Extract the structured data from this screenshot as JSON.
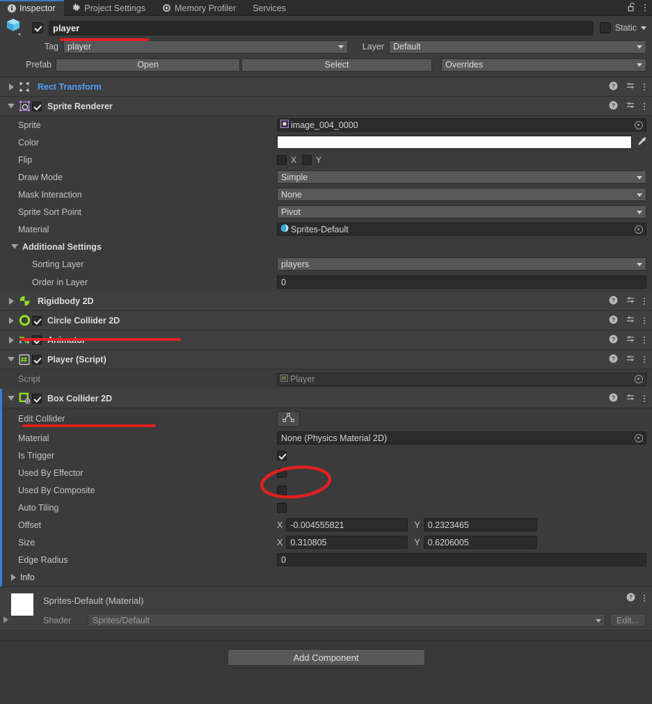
{
  "window": {
    "tabs": [
      {
        "label": "Inspector",
        "icon": "info-icon",
        "active": true
      },
      {
        "label": "Project Settings",
        "icon": "gear-icon",
        "active": false
      },
      {
        "label": "Memory Profiler",
        "icon": "memory-chip-icon",
        "active": false
      },
      {
        "label": "Services",
        "icon": "none",
        "active": false
      }
    ],
    "lock_icon": "unlocked-padlock-icon",
    "menu_icon": "kebab-menu-icon"
  },
  "object_header": {
    "icon": "prefab-cube-icon",
    "enabled": true,
    "name_value": "player",
    "static_label": "Static",
    "static_checked": false,
    "tag_label": "Tag",
    "tag_value": "player",
    "layer_label": "Layer",
    "layer_value": "Default",
    "prefab_label": "Prefab",
    "open_label": "Open",
    "select_label": "Select",
    "overrides_label": "Overrides"
  },
  "components": [
    {
      "id": "rect-transform",
      "title": "Rect Transform",
      "icon": "rect-transform-icon",
      "expanded": false,
      "has_toggle": false,
      "title_is_link": true
    },
    {
      "id": "sprite-renderer",
      "title": "Sprite Renderer",
      "icon": "sprite-renderer-icon",
      "expanded": true,
      "has_toggle": true,
      "enabled": true
    },
    {
      "id": "rigidbody-2d",
      "title": "Rigidbody 2D",
      "icon": "rigidbody-2d-icon",
      "expanded": false,
      "has_toggle": false
    },
    {
      "id": "circle-collider-2d",
      "title": "Circle Collider 2D",
      "icon": "circle-collider-2d-icon",
      "expanded": false,
      "has_toggle": true,
      "enabled": true
    },
    {
      "id": "animator",
      "title": "Animator",
      "icon": "animator-icon",
      "expanded": false,
      "has_toggle": true,
      "enabled": true
    },
    {
      "id": "player-script",
      "title": "Player (Script)",
      "icon": "csharp-script-icon",
      "expanded": true,
      "has_toggle": true,
      "enabled": true
    },
    {
      "id": "box-collider-2d",
      "title": "Box Collider 2D",
      "icon": "box-collider-2d-icon",
      "expanded": true,
      "has_toggle": true,
      "enabled": true,
      "selected": true
    }
  ],
  "sprite_renderer": {
    "sprite_label": "Sprite",
    "sprite_value": "image_004_0000",
    "sprite_icon": "sprite-asset-icon",
    "color_label": "Color",
    "color_value": "#ffffff",
    "eyedropper_icon": "eyedropper-icon",
    "flip_label": "Flip",
    "flip_x_label": "X",
    "flip_x_checked": false,
    "flip_y_label": "Y",
    "flip_y_checked": false,
    "draw_mode_label": "Draw Mode",
    "draw_mode_value": "Simple",
    "mask_interaction_label": "Mask Interaction",
    "mask_interaction_value": "None",
    "sprite_sort_point_label": "Sprite Sort Point",
    "sprite_sort_point_value": "Pivot",
    "material_label": "Material",
    "material_value": "Sprites-Default",
    "material_icon": "material-sphere-icon",
    "additional_settings_label": "Additional Settings",
    "sorting_layer_label": "Sorting Layer",
    "sorting_layer_value": "players",
    "order_in_layer_label": "Order in Layer",
    "order_in_layer_value": "0"
  },
  "player_script": {
    "script_label": "Script",
    "script_value": "Player",
    "script_icon": "csharp-script-icon"
  },
  "box_collider": {
    "edit_collider_label": "Edit Collider",
    "edit_collider_icon": "edit-collider-icon",
    "material_label": "Material",
    "material_value": "None (Physics Material 2D)",
    "is_trigger_label": "Is Trigger",
    "is_trigger_checked": true,
    "used_by_effector_label": "Used By Effector",
    "used_by_effector_checked": false,
    "used_by_composite_label": "Used By Composite",
    "used_by_composite_checked": false,
    "auto_tiling_label": "Auto Tiling",
    "auto_tiling_checked": false,
    "offset_label": "Offset",
    "offset_x_axis": "X",
    "offset_x": "-0.004555821",
    "offset_y_axis": "Y",
    "offset_y": "0.2323465",
    "size_label": "Size",
    "size_x_axis": "X",
    "size_x": "0.310805",
    "size_y_axis": "Y",
    "size_y": "0.6206005",
    "edge_radius_label": "Edge Radius",
    "edge_radius_value": "0",
    "info_label": "Info"
  },
  "material_preview": {
    "title": "Sprites-Default (Material)",
    "swatch_color": "#ffffff",
    "shader_label": "Shader",
    "shader_value": "Sprites/Default",
    "edit_label": "Edit...",
    "help_icon": "help-icon",
    "menu_icon": "kebab-menu-icon"
  },
  "footer": {
    "add_component_label": "Add Component"
  },
  "header_icons": {
    "help": "help-icon",
    "preset": "preset-sliders-icon",
    "menu": "kebab-menu-icon"
  },
  "annotations": {
    "color": "#e02020",
    "marks": [
      {
        "name": "underline-object-name",
        "type": "underline"
      },
      {
        "name": "underline-circle-collider-2d",
        "type": "underline"
      },
      {
        "name": "underline-box-collider-2d",
        "type": "underline"
      },
      {
        "name": "ellipse-is-trigger-checkbox",
        "type": "ellipse"
      }
    ]
  }
}
